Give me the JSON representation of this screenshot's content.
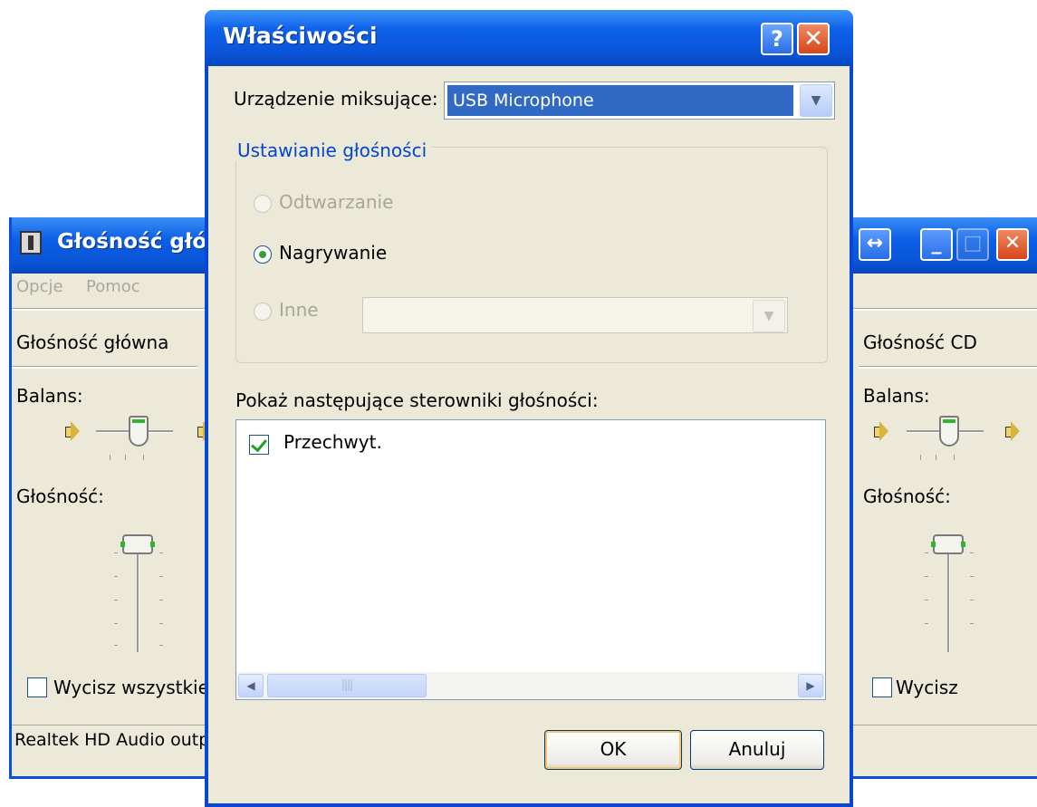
{
  "mixer": {
    "title": "Głośność główna",
    "menu": [
      "Opcje",
      "Pomoc"
    ],
    "left_channel": {
      "name": "Głośność główna",
      "balance_label": "Balans:",
      "volume_label": "Głośność:",
      "mute_label": "Wycisz wszystkie"
    },
    "right_channel": {
      "name": "Głośność CD",
      "balance_label": "Balans:",
      "volume_label": "Głośność:",
      "mute_label": "Wycisz"
    },
    "status_text": "Realtek HD Audio output",
    "titlebar_buttons": {
      "expand": "↔",
      "minimize": "_",
      "maximize": "□",
      "close": "✕"
    }
  },
  "dialog": {
    "title": "Właściwości",
    "help_button": "?",
    "close_button": "✕",
    "mixer_device_label": "Urządzenie miksujące:",
    "mixer_device_value": "USB Microphone",
    "volume_group_title": "Ustawianie głośności",
    "radio_playback": "Odtwarzanie",
    "radio_recording": "Nagrywanie",
    "radio_other": "Inne",
    "selected_radio": "Nagrywanie",
    "controls_label": "Pokaż następujące sterowniki głośności:",
    "controls_list": [
      {
        "label": "Przechwyt.",
        "checked": true
      }
    ],
    "ok_button": "OK",
    "cancel_button": "Anuluj"
  },
  "colors": {
    "titlebar_blue": "#0a55d9",
    "window_bg": "#ece9d8",
    "selection_blue": "#316ac5",
    "group_title": "#0046d5"
  }
}
